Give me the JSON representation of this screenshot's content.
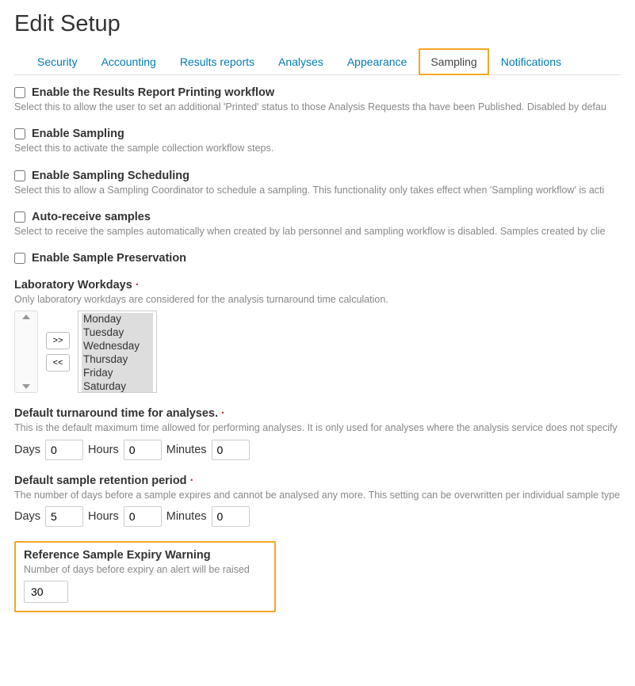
{
  "title": "Edit Setup",
  "tabs": {
    "security": "Security",
    "accounting": "Accounting",
    "results_reports": "Results reports",
    "analyses": "Analyses",
    "appearance": "Appearance",
    "sampling": "Sampling",
    "notifications": "Notifications"
  },
  "fields": {
    "enable_report_printing": {
      "label": "Enable the Results Report Printing workflow",
      "help": "Select this to allow the user to set an additional 'Printed' status to those Analysis Requests tha have been Published. Disabled by defau"
    },
    "enable_sampling": {
      "label": "Enable Sampling",
      "help": "Select this to activate the sample collection workflow steps."
    },
    "enable_sampling_sched": {
      "label": "Enable Sampling Scheduling",
      "help": "Select this to allow a Sampling Coordinator to schedule a sampling. This functionality only takes effect when 'Sampling workflow' is acti"
    },
    "auto_receive": {
      "label": "Auto-receive samples",
      "help": "Select to receive the samples automatically when created by lab personnel and sampling workflow is disabled. Samples created by clie"
    },
    "enable_preservation": {
      "label": "Enable Sample Preservation"
    },
    "workdays": {
      "label": "Laboratory Workdays",
      "help": "Only laboratory workdays are considered for the analysis turnaround time calculation.",
      "btn_add": ">>",
      "btn_remove": "<<",
      "options": [
        "Monday",
        "Tuesday",
        "Wednesday",
        "Thursday",
        "Friday",
        "Saturday"
      ]
    },
    "turnaround": {
      "label": "Default turnaround time for analyses.",
      "help": "This is the default maximum time allowed for performing analyses. It is only used for analyses where the analysis service does not specify",
      "days_label": "Days",
      "days": "0",
      "hours_label": "Hours",
      "hours": "0",
      "minutes_label": "Minutes",
      "minutes": "0"
    },
    "retention": {
      "label": "Default sample retention period",
      "help": "The number of days before a sample expires and cannot be analysed any more. This setting can be overwritten per individual sample type",
      "days_label": "Days",
      "days": "5",
      "hours_label": "Hours",
      "hours": "0",
      "minutes_label": "Minutes",
      "minutes": "0"
    },
    "expiry_warning": {
      "label": "Reference Sample Expiry Warning",
      "help": "Number of days before expiry an alert will be raised",
      "value": "30"
    }
  }
}
